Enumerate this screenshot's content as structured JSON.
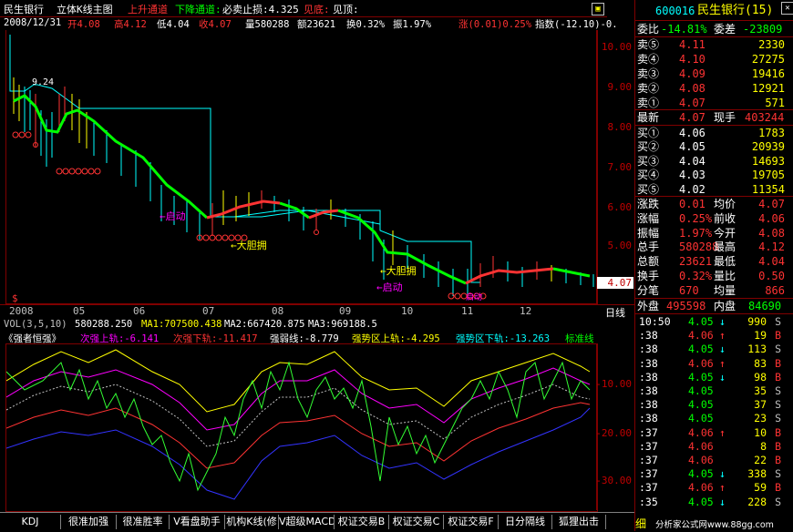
{
  "header": {
    "stock": "民生银行",
    "chart_mode": "立体K线主图",
    "up_channel": "上升通道",
    "down_channel": "下降通道:",
    "stop_loss": "必卖止损:4.325",
    "bottom": "见底:",
    "top": "见顶:"
  },
  "info": {
    "date": "2008/12/31",
    "open": "开4.08",
    "high": "高4.12",
    "low": "低4.04",
    "close": "收4.07",
    "volume": "量580288",
    "amount": "额23621",
    "turnover": "换0.32%",
    "amplitude": "振1.97%",
    "change": "涨(0.01)0.25%",
    "index": "指数(-12.10)-0."
  },
  "price_axis": [
    "10.00",
    "9.00",
    "8.00",
    "7.00",
    "6.00",
    "5.00",
    "4.07"
  ],
  "price_current": "4.07",
  "annotations": {
    "a924": "9.24",
    "dadan1": "←大胆拥",
    "dadan2": "←大胆拥",
    "qidong": "←启动",
    "qidong2": "←启动",
    "shiqi": "启动"
  },
  "x_axis": [
    "2008",
    "05",
    "06",
    "07",
    "08",
    "09",
    "10",
    "11",
    "12"
  ],
  "period_label": "日线",
  "vol_legend": {
    "title": "VOL(3,5,10)",
    "v": "580288.250",
    "ma1": "MA1:707500.438",
    "ma2": "MA2:667420.875",
    "ma3": "MA3:969188.5"
  },
  "ind_legend": {
    "name": "《强者恒强》",
    "a": "次强上轨:-6.141",
    "b": "次强下轨:-11.417",
    "c": "强弱线:-8.779",
    "d": "强势区上轨:-4.295",
    "e": "强势区下轨:-13.263",
    "f": "标准线"
  },
  "ind_axis": [
    "-10.00",
    "-20.00",
    "-30.00"
  ],
  "tabs": [
    "KDJ",
    "很准加强",
    "很准胜率",
    "V看盘助手",
    "机构K线(修",
    "V超级MACD",
    "权证交易B",
    "权证交易C",
    "权证交易F",
    "日分隔线",
    "狐狸出击"
  ],
  "quote": {
    "code": "600016",
    "name": "民生银行(15)",
    "weibi_label": "委比",
    "weibi": "-14.81%",
    "weicha_label": "委差",
    "weicha": "-23809",
    "sells": [
      {
        "label": "卖⑤",
        "price": "4.11",
        "vol": "2330"
      },
      {
        "label": "卖④",
        "price": "4.10",
        "vol": "27275"
      },
      {
        "label": "卖③",
        "price": "4.09",
        "vol": "19416"
      },
      {
        "label": "卖②",
        "price": "4.08",
        "vol": "12921"
      },
      {
        "label": "卖①",
        "price": "4.07",
        "vol": "571"
      }
    ],
    "latest_label": "最新",
    "latest": "4.07",
    "xianshou_label": "现手",
    "xianshou": "403244",
    "buys": [
      {
        "label": "买①",
        "price": "4.06",
        "vol": "1783"
      },
      {
        "label": "买②",
        "price": "4.05",
        "vol": "20939"
      },
      {
        "label": "买③",
        "price": "4.04",
        "vol": "14693"
      },
      {
        "label": "买④",
        "price": "4.03",
        "vol": "19705"
      },
      {
        "label": "买⑤",
        "price": "4.02",
        "vol": "11354"
      }
    ],
    "stats": [
      {
        "l1": "涨跌",
        "v1": "0.01",
        "l2": "均价",
        "v2": "4.07"
      },
      {
        "l1": "涨幅",
        "v1": "0.25%",
        "l2": "前收",
        "v2": "4.06"
      },
      {
        "l1": "振幅",
        "v1": "1.97%",
        "l2": "今开",
        "v2": "4.08"
      },
      {
        "l1": "总手",
        "v1": "580288",
        "l2": "最高",
        "v2": "4.12"
      },
      {
        "l1": "总额",
        "v1": "23621",
        "l2": "最低",
        "v2": "4.04"
      },
      {
        "l1": "换手",
        "v1": "0.32%",
        "l2": "量比",
        "v2": "0.50"
      },
      {
        "l1": "分笔",
        "v1": "670",
        "l2": "均量",
        "v2": "866"
      }
    ],
    "waipan_label": "外盘",
    "waipan": "495598",
    "neipan_label": "内盘",
    "neipan": "84690"
  },
  "ticks": [
    {
      "t": "10:50",
      "p": "4.05",
      "a": "↓",
      "v": "990",
      "s": "S"
    },
    {
      "t": ":38",
      "p": "4.06",
      "a": "↑",
      "v": "19",
      "s": "B"
    },
    {
      "t": ":38",
      "p": "4.05",
      "a": "↓",
      "v": "113",
      "s": "S"
    },
    {
      "t": ":38",
      "p": "4.06",
      "a": "↑",
      "v": "83",
      "s": "B"
    },
    {
      "t": ":38",
      "p": "4.05",
      "a": "↓",
      "v": "98",
      "s": "B"
    },
    {
      "t": ":38",
      "p": "4.05",
      "a": "",
      "v": "35",
      "s": "S"
    },
    {
      "t": ":38",
      "p": "4.05",
      "a": "",
      "v": "37",
      "s": "S"
    },
    {
      "t": ":38",
      "p": "4.05",
      "a": "",
      "v": "23",
      "s": "S"
    },
    {
      "t": ":37",
      "p": "4.06",
      "a": "↑",
      "v": "10",
      "s": "B"
    },
    {
      "t": ":37",
      "p": "4.06",
      "a": "",
      "v": "8",
      "s": "B"
    },
    {
      "t": ":37",
      "p": "4.06",
      "a": "",
      "v": "22",
      "s": "B"
    },
    {
      "t": ":37",
      "p": "4.05",
      "a": "↓",
      "v": "338",
      "s": "S"
    },
    {
      "t": ":37",
      "p": "4.06",
      "a": "↑",
      "v": "59",
      "s": "B"
    },
    {
      "t": ":35",
      "p": "4.05",
      "a": "↓",
      "v": "228",
      "s": "S"
    }
  ],
  "footer_tab": "细",
  "watermark": "分析家公式网www.88gg.com",
  "colors": {
    "up": "#ff3333",
    "down": "#00ff00",
    "axis": "#800000",
    "bg": "#000000"
  }
}
